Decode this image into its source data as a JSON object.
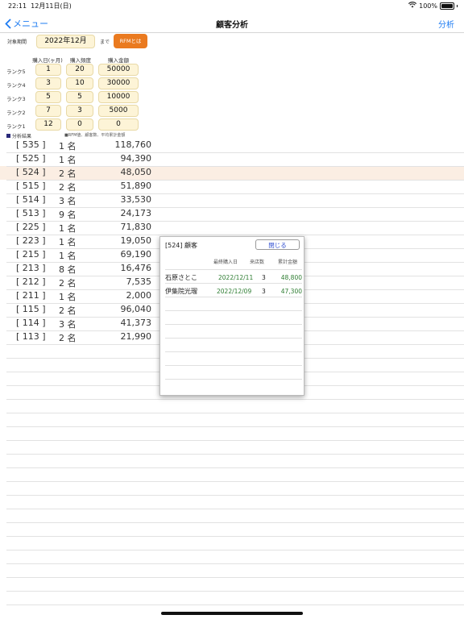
{
  "status": {
    "time": "22:11",
    "date": "12月11日(日)",
    "battery": "100%"
  },
  "nav": {
    "back_label": "メニュー",
    "title": "顧客分析",
    "action_label": "分析"
  },
  "period": {
    "label": "対象期間",
    "value": "2022年12月",
    "until": "まで",
    "rfm_button": "RFMとは"
  },
  "rank_table": {
    "headers": [
      "購入日(ヶ月)",
      "購入頻度",
      "購入金額"
    ],
    "rows": [
      {
        "label": "ランク5",
        "values": [
          "1",
          "20",
          "50000"
        ]
      },
      {
        "label": "ランク4",
        "values": [
          "3",
          "10",
          "30000"
        ]
      },
      {
        "label": "ランク3",
        "values": [
          "5",
          "5",
          "10000"
        ]
      },
      {
        "label": "ランク2",
        "values": [
          "7",
          "3",
          "5000"
        ]
      },
      {
        "label": "ランク1",
        "values": [
          "12",
          "0",
          "0"
        ]
      }
    ]
  },
  "results": {
    "legend": "分析結果",
    "note": "■RFM値、顧客数、平均累計金額",
    "rows": [
      {
        "code": "[ 535 ]",
        "count": "1 名",
        "amount": "118,760"
      },
      {
        "code": "[ 525 ]",
        "count": "1 名",
        "amount": "94,390"
      },
      {
        "code": "[ 524 ]",
        "count": "2 名",
        "amount": "48,050"
      },
      {
        "code": "[ 515 ]",
        "count": "2 名",
        "amount": "51,890"
      },
      {
        "code": "[ 514 ]",
        "count": "3 名",
        "amount": "33,530"
      },
      {
        "code": "[ 513 ]",
        "count": "9 名",
        "amount": "24,173"
      },
      {
        "code": "[ 225 ]",
        "count": "1 名",
        "amount": "71,830"
      },
      {
        "code": "[ 223 ]",
        "count": "1 名",
        "amount": "19,050"
      },
      {
        "code": "[ 215 ]",
        "count": "1 名",
        "amount": "69,190"
      },
      {
        "code": "[ 213 ]",
        "count": "8 名",
        "amount": "16,476"
      },
      {
        "code": "[ 212 ]",
        "count": "2 名",
        "amount": "7,535"
      },
      {
        "code": "[ 211 ]",
        "count": "1 名",
        "amount": "2,000"
      },
      {
        "code": "[ 115 ]",
        "count": "2 名",
        "amount": "96,040"
      },
      {
        "code": "[ 114 ]",
        "count": "3 名",
        "amount": "41,373"
      },
      {
        "code": "[ 113 ]",
        "count": "2 名",
        "amount": "21,990"
      }
    ],
    "selected_index": 2
  },
  "popup": {
    "title": "[524] 顧客",
    "close_label": "閉じる",
    "headers": [
      "最終購入日",
      "来店数",
      "累計金額"
    ],
    "rows": [
      {
        "name": "石原さとこ",
        "date": "2022/12/11",
        "visits": "3",
        "total": "48,800"
      },
      {
        "name": "伊集院光瑠",
        "date": "2022/12/09",
        "visits": "3",
        "total": "47,300"
      }
    ]
  },
  "colors": {
    "accent": "#1e7cf2",
    "rfm_button": "#ea7a1f",
    "cell_bg": "#fdf4d7",
    "selected_row": "#fbeee3",
    "green_text": "#2e7d32"
  }
}
